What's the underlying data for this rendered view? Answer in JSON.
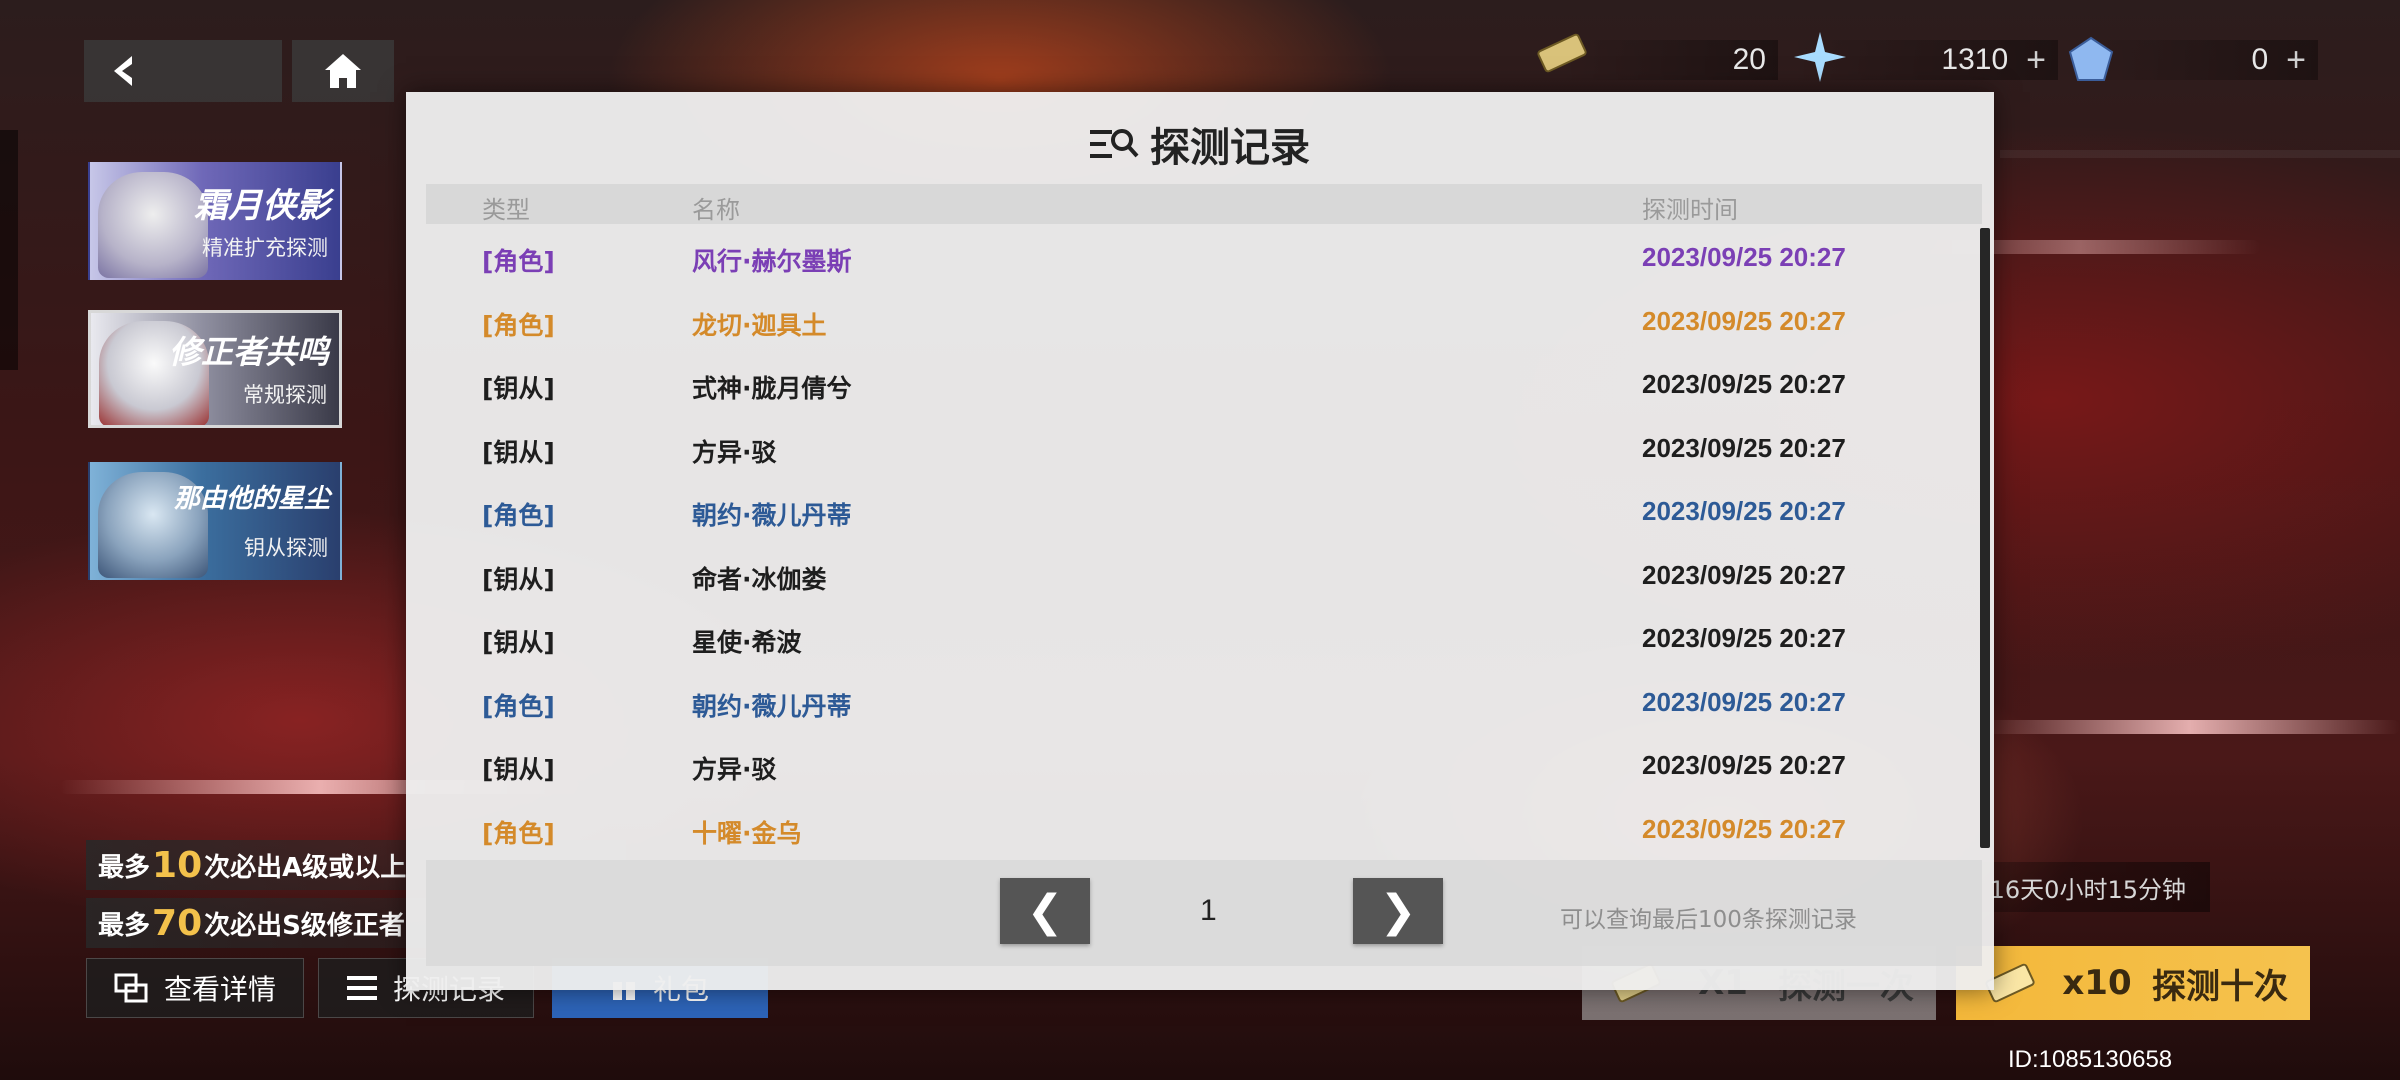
{
  "colors": {
    "purple": "#7b3fb5",
    "orange": "#d48a2a",
    "blue": "#2d5a96",
    "black": "#1e1e1e",
    "gold": "#f3c14b"
  },
  "currency": [
    {
      "icon": "ticket-icon",
      "value": "20"
    },
    {
      "icon": "crystal-icon",
      "value": "1310"
    },
    {
      "icon": "gem-icon",
      "value": "0"
    }
  ],
  "banners": [
    {
      "title": "霜月侠影",
      "subtitle": "精准扩充探测"
    },
    {
      "title": "修正者共鸣",
      "subtitle": "常规探测"
    },
    {
      "title": "那由他的星尘",
      "subtitle": "钥从探测"
    }
  ],
  "info": {
    "line1": {
      "prefix": "最多",
      "num": "10",
      "suffix": "次必出A级或以上"
    },
    "line2": {
      "prefix": "最多",
      "num": "70",
      "suffix": "次必出S级修正者"
    }
  },
  "bottom_buttons": {
    "details": "查看详情",
    "records": "探测记录",
    "gift": "礼包"
  },
  "timer": "16天0小时15分钟",
  "draw": {
    "one_count": "X1",
    "one_label": "探测一次",
    "ten_count": "x10",
    "ten_label": "探测十次"
  },
  "uid": "ID:1085130658",
  "modal": {
    "title": "探测记录",
    "headers": {
      "type": "类型",
      "name": "名称",
      "time": "探测时间"
    },
    "rows": [
      {
        "type": "[角色]",
        "name": "风行·赫尔墨斯",
        "time": "2023/09/25 20:27",
        "color": "purple"
      },
      {
        "type": "[角色]",
        "name": "龙切·迦具土",
        "time": "2023/09/25 20:27",
        "color": "orange"
      },
      {
        "type": "[钥从]",
        "name": "式神·胧月倩兮",
        "time": "2023/09/25 20:27",
        "color": "black"
      },
      {
        "type": "[钥从]",
        "name": "方异·驳",
        "time": "2023/09/25 20:27",
        "color": "black"
      },
      {
        "type": "[角色]",
        "name": "朝约·薇儿丹蒂",
        "time": "2023/09/25 20:27",
        "color": "blue"
      },
      {
        "type": "[钥从]",
        "name": "命者·冰伽娄",
        "time": "2023/09/25 20:27",
        "color": "black"
      },
      {
        "type": "[钥从]",
        "name": "星使·希波",
        "time": "2023/09/25 20:27",
        "color": "black"
      },
      {
        "type": "[角色]",
        "name": "朝约·薇儿丹蒂",
        "time": "2023/09/25 20:27",
        "color": "blue"
      },
      {
        "type": "[钥从]",
        "name": "方异·驳",
        "time": "2023/09/25 20:27",
        "color": "black"
      },
      {
        "type": "[角色]",
        "name": "十曜·金乌",
        "time": "2023/09/25 20:27",
        "color": "orange"
      }
    ],
    "page": "1",
    "prev": "❮",
    "next": "❯",
    "hint": "可以查询最后100条探测记录"
  }
}
